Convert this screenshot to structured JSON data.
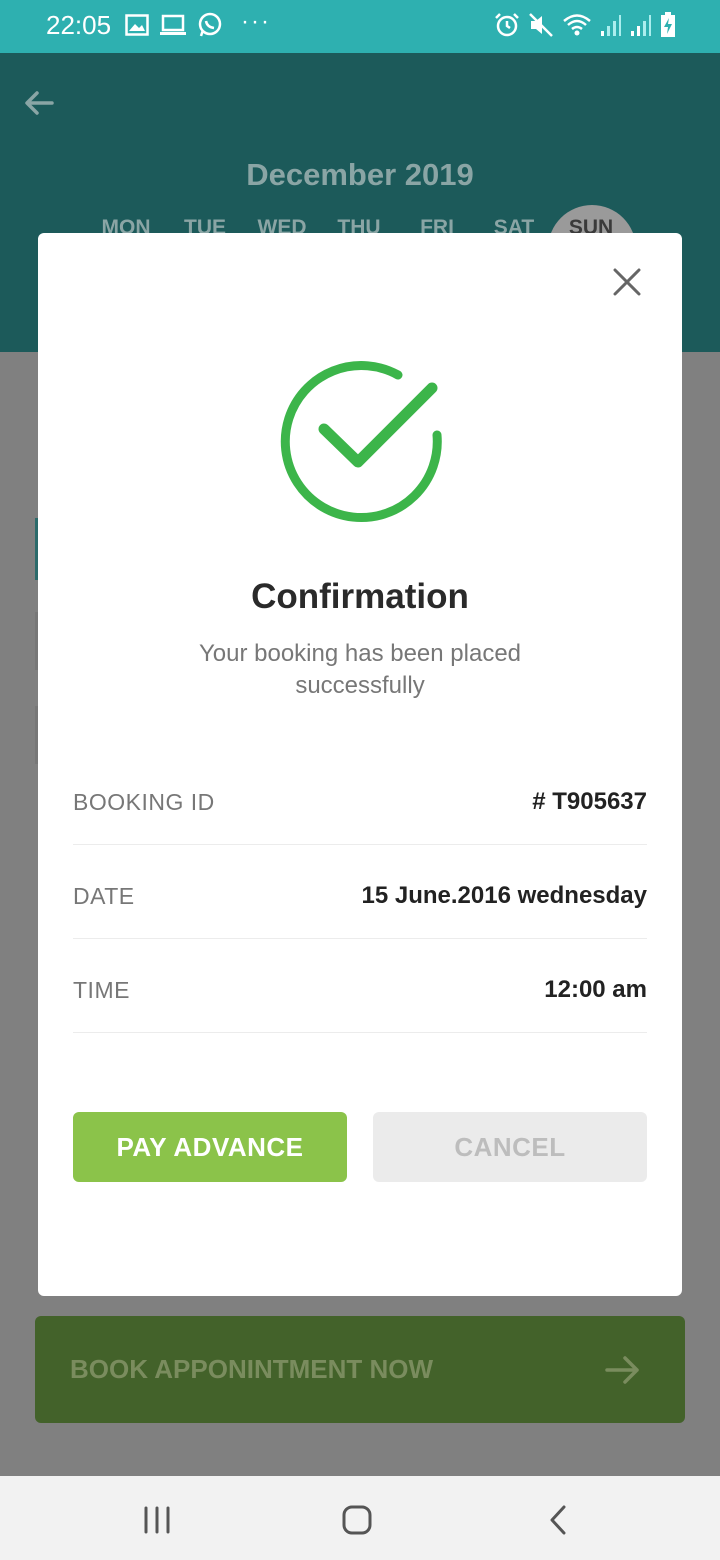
{
  "status_bar": {
    "time": "22:05",
    "left_icons": [
      "image-icon",
      "laptop-icon",
      "whatsapp-icon",
      "more-dots-icon"
    ],
    "more_dots": "···",
    "right_icons": [
      "alarm-icon",
      "mute-icon",
      "wifi-icon",
      "signal-icon",
      "signal-icon",
      "battery-charging-icon"
    ]
  },
  "header": {
    "month_title": "December 2019",
    "weekdays": [
      "MON",
      "TUE",
      "WED",
      "THU",
      "FRI",
      "SAT",
      "SUN"
    ],
    "selected_day": "SUN"
  },
  "modal": {
    "title": "Confirmation",
    "subtitle": "Your booking has been placed successfully",
    "rows": [
      {
        "label": "BOOKING ID",
        "value": "# T905637"
      },
      {
        "label": "DATE",
        "value": "15 June.2016 wednesday"
      },
      {
        "label": "TIME",
        "value": "12:00 am"
      }
    ],
    "pay_label": "PAY ADVANCE",
    "cancel_label": "CANCEL"
  },
  "book_button": {
    "label": "BOOK APPONINTMENT NOW"
  },
  "colors": {
    "status_bar": "#2eb0b0",
    "header": "#1c5a5a",
    "success_green": "#3cb54a",
    "pay_button": "#8bc34a",
    "cancel_button": "#ebebeb",
    "book_button": "#43622a"
  }
}
